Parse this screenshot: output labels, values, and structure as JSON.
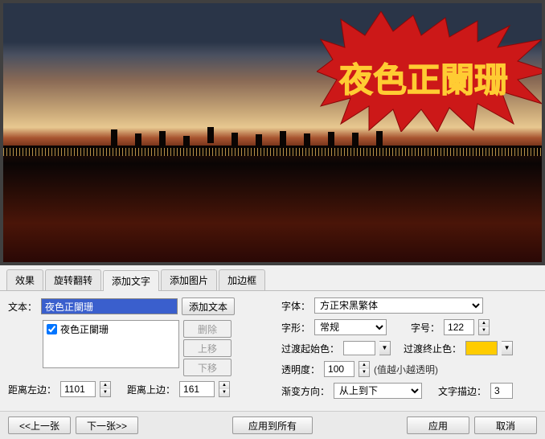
{
  "preview": {
    "overlay_text": "夜色正闌珊"
  },
  "tabs": {
    "effects": "效果",
    "rotate": "旋转翻转",
    "add_text": "添加文字",
    "add_image": "添加图片",
    "add_border": "加边框"
  },
  "panel": {
    "text_label": "文本：",
    "text_value": "夜色正闌珊",
    "add_text_btn": "添加文本",
    "delete_btn": "删除",
    "move_up_btn": "上移",
    "move_down_btn": "下移",
    "list_item_checked": true,
    "list_item_label": "夜色正闌珊",
    "margin_left_label": "距离左边：",
    "margin_left_value": "1101",
    "margin_top_label": "距离上边：",
    "margin_top_value": "161",
    "font_label": "字体：",
    "font_value": "方正宋黑繁体",
    "style_label": "字形：",
    "style_value": "常规",
    "size_label": "字号：",
    "size_value": "122",
    "gradient_start_label": "过渡起始色：",
    "gradient_end_label": "过渡终止色：",
    "gradient_start_color": "#ffffff",
    "gradient_end_color": "#ffcc00",
    "opacity_label": "透明度：",
    "opacity_value": "100",
    "opacity_hint": "(值越小越透明)",
    "gradient_dir_label": "渐变方向：",
    "gradient_dir_value": "从上到下",
    "stroke_label": "文字描边：",
    "stroke_value": "3"
  },
  "bottom": {
    "prev": "<<上一张",
    "next": "下一张>>",
    "apply_all": "应用到所有",
    "apply": "应用",
    "cancel": "取消"
  }
}
